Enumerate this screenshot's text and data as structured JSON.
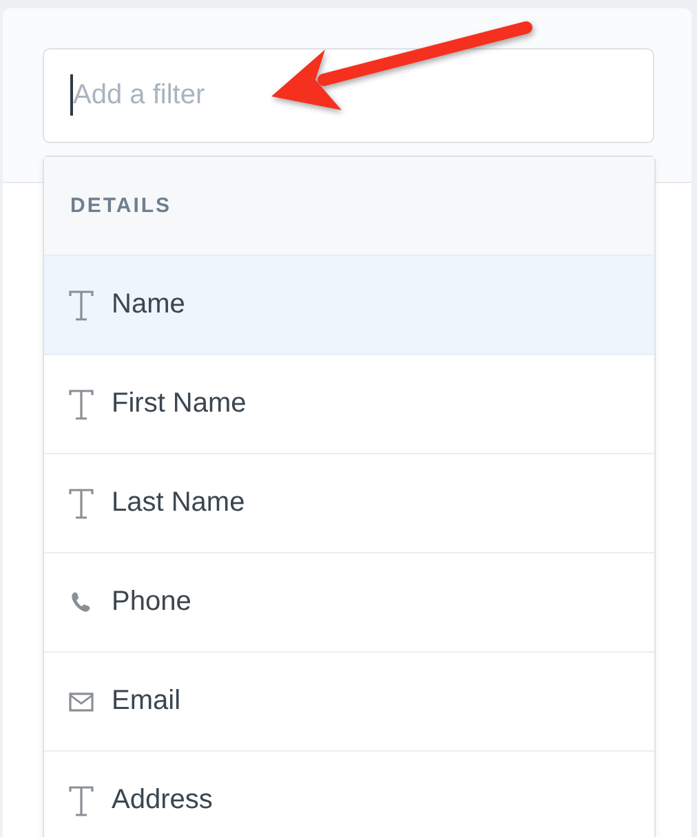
{
  "search": {
    "placeholder": "Add a filter"
  },
  "dropdown": {
    "heading": "DETAILS",
    "items": [
      {
        "label": "Name",
        "kind": "text",
        "selected": true
      },
      {
        "label": "First Name",
        "kind": "text",
        "selected": false
      },
      {
        "label": "Last Name",
        "kind": "text",
        "selected": false
      },
      {
        "label": "Phone",
        "kind": "phone",
        "selected": false
      },
      {
        "label": "Email",
        "kind": "email",
        "selected": false
      },
      {
        "label": "Address",
        "kind": "text",
        "selected": false
      }
    ]
  }
}
